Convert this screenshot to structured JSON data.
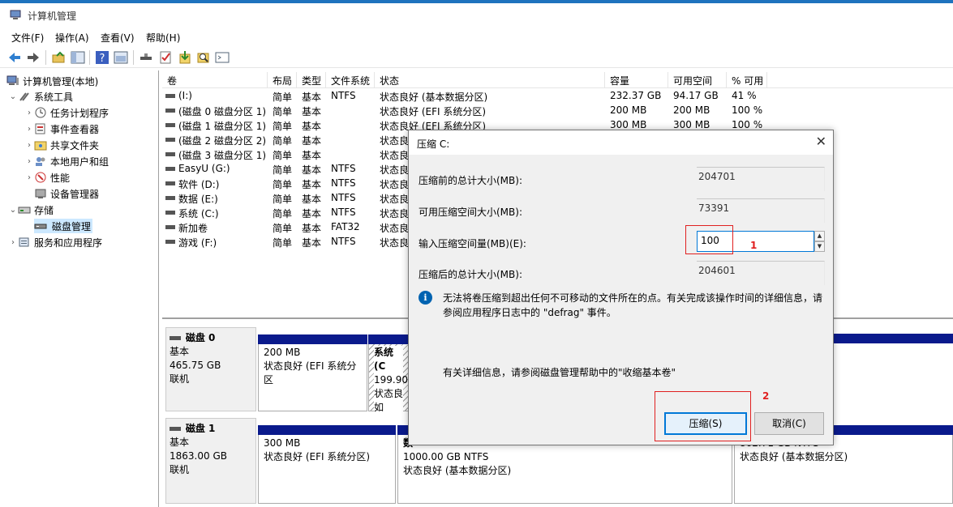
{
  "window": {
    "title": "计算机管理"
  },
  "menu": [
    "文件(F)",
    "操作(A)",
    "查看(V)",
    "帮助(H)"
  ],
  "tree": {
    "root": "计算机管理(本地)",
    "system_tools": "系统工具",
    "task_scheduler": "任务计划程序",
    "event_viewer": "事件查看器",
    "shared_folders": "共享文件夹",
    "local_users": "本地用户和组",
    "performance": "性能",
    "device_manager": "设备管理器",
    "storage": "存储",
    "disk_management": "磁盘管理",
    "services": "服务和应用程序"
  },
  "columns": [
    "卷",
    "布局",
    "类型",
    "文件系统",
    "状态",
    "容量",
    "可用空间",
    "% 可用"
  ],
  "volumes": [
    [
      "(I:)",
      "简单",
      "基本",
      "NTFS",
      "状态良好 (基本数据分区)",
      "232.37 GB",
      "94.17 GB",
      "41 %"
    ],
    [
      "(磁盘 0 磁盘分区 1)",
      "简单",
      "基本",
      "",
      "状态良好 (EFI 系统分区)",
      "200 MB",
      "200 MB",
      "100 %"
    ],
    [
      "(磁盘 1 磁盘分区 1)",
      "简单",
      "基本",
      "",
      "状态良好 (EFI 系统分区)",
      "300 MB",
      "300 MB",
      "100 %"
    ],
    [
      "(磁盘 2 磁盘分区 2)",
      "简单",
      "基本",
      "",
      "状态良",
      "",
      "",
      ""
    ],
    [
      "(磁盘 3 磁盘分区 1)",
      "简单",
      "基本",
      "",
      "状态良",
      "",
      "",
      ""
    ],
    [
      "EasyU (G:)",
      "简单",
      "基本",
      "NTFS",
      "状态良",
      "",
      "",
      ""
    ],
    [
      "软件 (D:)",
      "简单",
      "基本",
      "NTFS",
      "状态良",
      "",
      "",
      ""
    ],
    [
      "数据 (E:)",
      "简单",
      "基本",
      "NTFS",
      "状态良",
      "",
      "",
      ""
    ],
    [
      "系统 (C:)",
      "简单",
      "基本",
      "NTFS",
      "状态良",
      "",
      "",
      ""
    ],
    [
      "新加卷",
      "简单",
      "基本",
      "FAT32",
      "状态良",
      "",
      "",
      ""
    ],
    [
      "游戏 (F:)",
      "简单",
      "基本",
      "NTFS",
      "状态良",
      "",
      "",
      ""
    ]
  ],
  "disks": [
    {
      "name": "磁盘 0",
      "type": "基本",
      "size": "465.75 GB",
      "status": "联机",
      "parts": [
        {
          "line1": "",
          "line2": "200 MB",
          "line3": "状态良好 (EFI 系统分区"
        },
        {
          "line1": "系统 (C",
          "line2": "199.90",
          "line3": "状态良如"
        }
      ]
    },
    {
      "name": "磁盘 1",
      "type": "基本",
      "size": "1863.00 GB",
      "status": "联机",
      "parts": [
        {
          "line1": "",
          "line2": "300 MB",
          "line3": "状态良好 (EFI 系统分区)"
        },
        {
          "line1": "数",
          "line2": "1000.00 GB NTFS",
          "line3": "状态良好 (基本数据分区)"
        },
        {
          "line1": "",
          "line2": "862.71 GB NTFS",
          "line3": "状态良好 (基本数据分区)"
        }
      ]
    }
  ],
  "dialog": {
    "title": "压缩 C:",
    "total_before_label": "压缩前的总计大小(MB):",
    "total_before": "204701",
    "available_label": "可用压缩空间大小(MB):",
    "available": "73391",
    "input_label": "输入压缩空间量(MB)(E):",
    "input_value": "100",
    "total_after_label": "压缩后的总计大小(MB):",
    "total_after": "204601",
    "info": "无法将卷压缩到超出任何不可移动的文件所在的点。有关完成该操作时间的详细信息，请参阅应用程序日志中的 \"defrag\" 事件。",
    "help": "有关详细信息，请参阅磁盘管理帮助中的\"收缩基本卷\"",
    "shrink_button": "压缩(S)",
    "cancel_button": "取消(C)"
  },
  "annotations": {
    "badge1": "1",
    "badge2": "2"
  },
  "colors": {
    "accent": "#0078d7",
    "disk_bar": "#0a1a8c",
    "annotation": "#e02020"
  }
}
